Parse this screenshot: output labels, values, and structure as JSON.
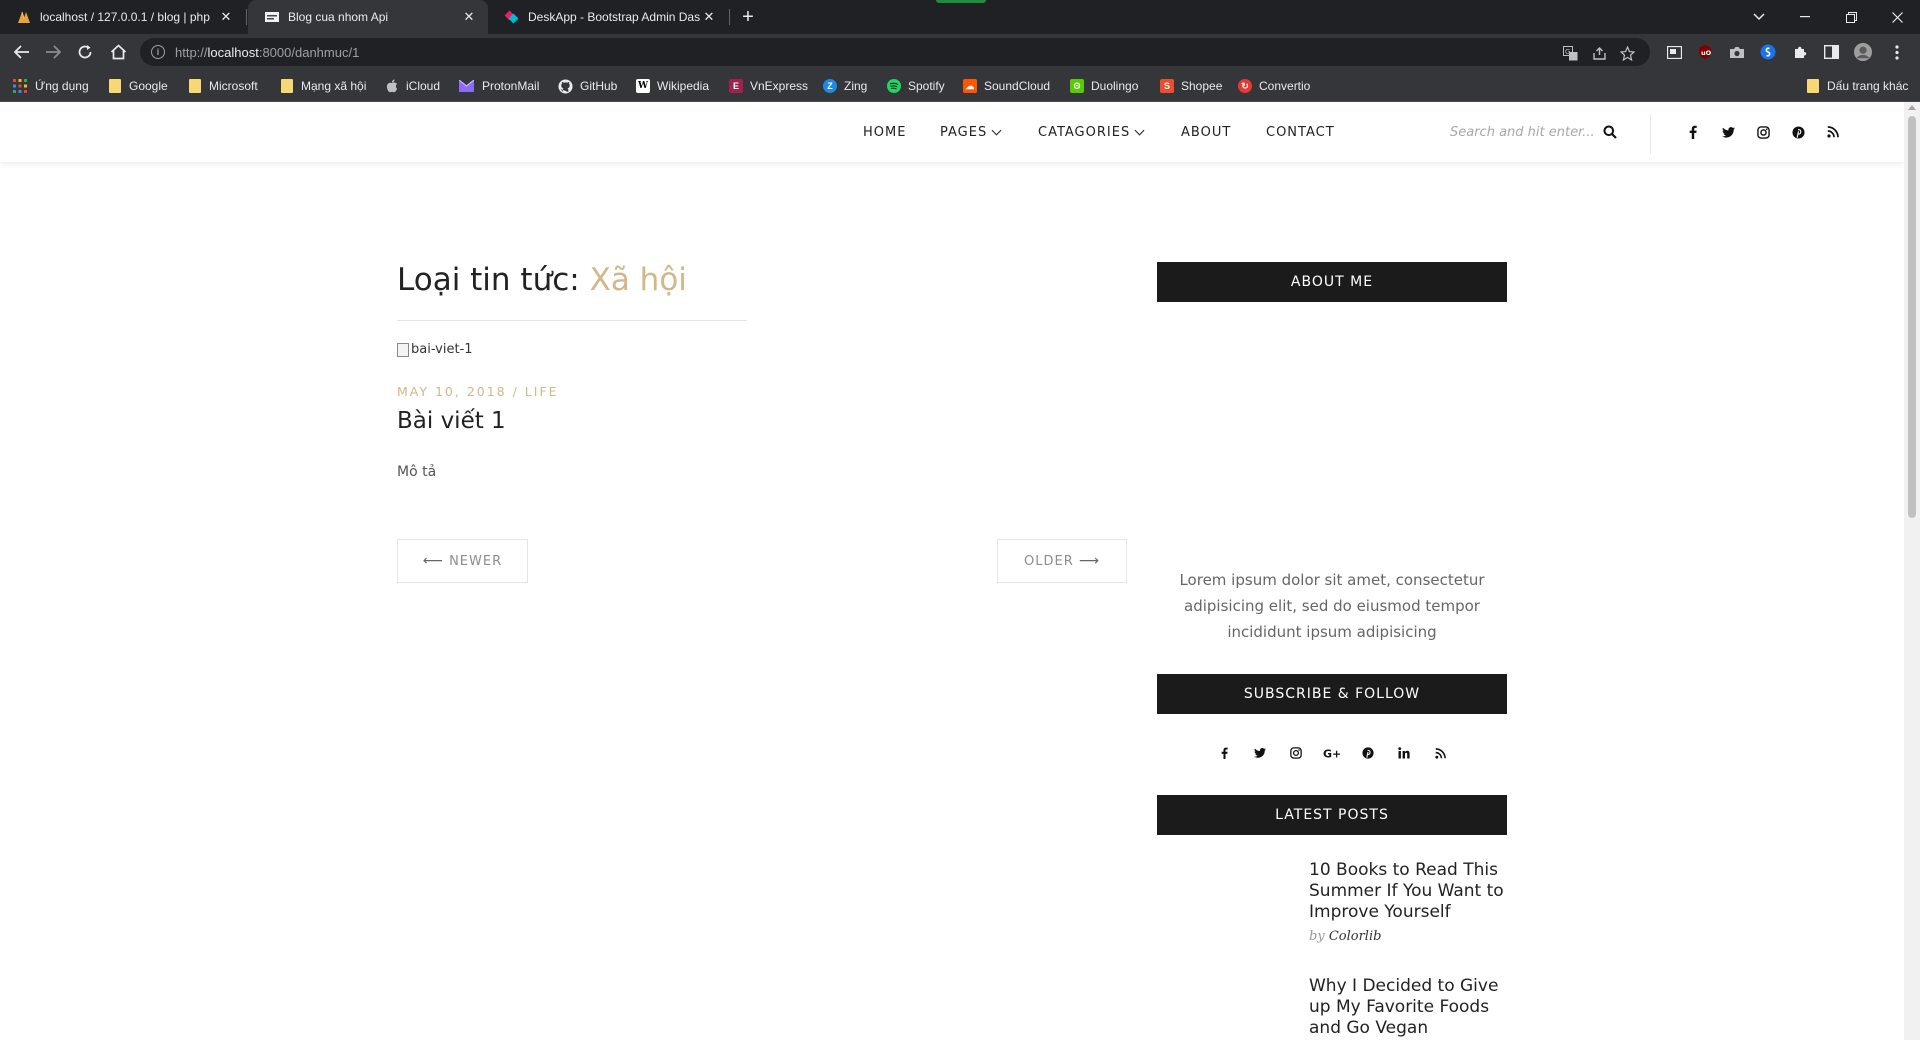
{
  "browser": {
    "tabs": [
      {
        "title": "localhost / 127.0.0.1 / blog | php",
        "active": false
      },
      {
        "title": "Blog cua nhom Api",
        "active": true
      },
      {
        "title": "DeskApp - Bootstrap Admin Das",
        "active": false
      }
    ],
    "url_host": "localhost",
    "url_prefix": "http://",
    "url_path": ":8000/danhmuc/1",
    "bookmarks": [
      {
        "label": "Ứng dụng",
        "icon": "apps-grid-icon"
      },
      {
        "label": "Google",
        "icon": "folder-icon"
      },
      {
        "label": "Microsoft",
        "icon": "folder-icon"
      },
      {
        "label": "Mạng xã hội",
        "icon": "folder-icon"
      },
      {
        "label": "iCloud",
        "icon": "apple-icon"
      },
      {
        "label": "ProtonMail",
        "icon": "protonmail-icon"
      },
      {
        "label": "GitHub",
        "icon": "github-icon"
      },
      {
        "label": "Wikipedia",
        "icon": "wikipedia-icon"
      },
      {
        "label": "VnExpress",
        "icon": "vnexpress-icon"
      },
      {
        "label": "Zing",
        "icon": "zing-icon"
      },
      {
        "label": "Spotify",
        "icon": "spotify-icon"
      },
      {
        "label": "SoundCloud",
        "icon": "soundcloud-icon"
      },
      {
        "label": "Duolingo",
        "icon": "duolingo-icon"
      },
      {
        "label": "Shopee",
        "icon": "shopee-icon"
      },
      {
        "label": "Convertio",
        "icon": "convertio-icon"
      }
    ],
    "other_bookmarks": "Dấu trang khác"
  },
  "site": {
    "menu": {
      "home": "HOME",
      "pages": "PAGES",
      "categories": "CATAGORIES",
      "about": "ABOUT",
      "contact": "CONTACT"
    },
    "search_placeholder": "Search and hit enter...",
    "heading_prefix": "Loại tin tức:",
    "heading_category": "Xã hội",
    "post": {
      "image_alt": "bai-viet-1",
      "meta": "MAY 10, 2018 / LIFE",
      "title": "Bài viết 1",
      "description": "Mô tả"
    },
    "pager": {
      "newer": "NEWER",
      "older": "OLDER"
    },
    "sidebar": {
      "about_title": "ABOUT ME",
      "about_text": "Lorem ipsum dolor sit amet, consectetur adipisicing elit, sed do eiusmod tempor incididunt ipsum adipisicing",
      "subscribe_title": "SUBSCRIBE & FOLLOW",
      "latest_title": "LATEST POSTS",
      "latest_posts": [
        {
          "title": "10 Books to Read This Summer If You Want to Improve Yourself",
          "by": "by",
          "author": "Colorlib"
        },
        {
          "title": "Why I Decided to Give up My Favorite Foods and Go Vegan",
          "by": "",
          "author": ""
        }
      ]
    }
  },
  "colors": {
    "accent": "#d0b889",
    "widget_bg": "#1b1b1b",
    "chrome_dark": "#202124",
    "chrome_toolbar": "#35363a"
  }
}
